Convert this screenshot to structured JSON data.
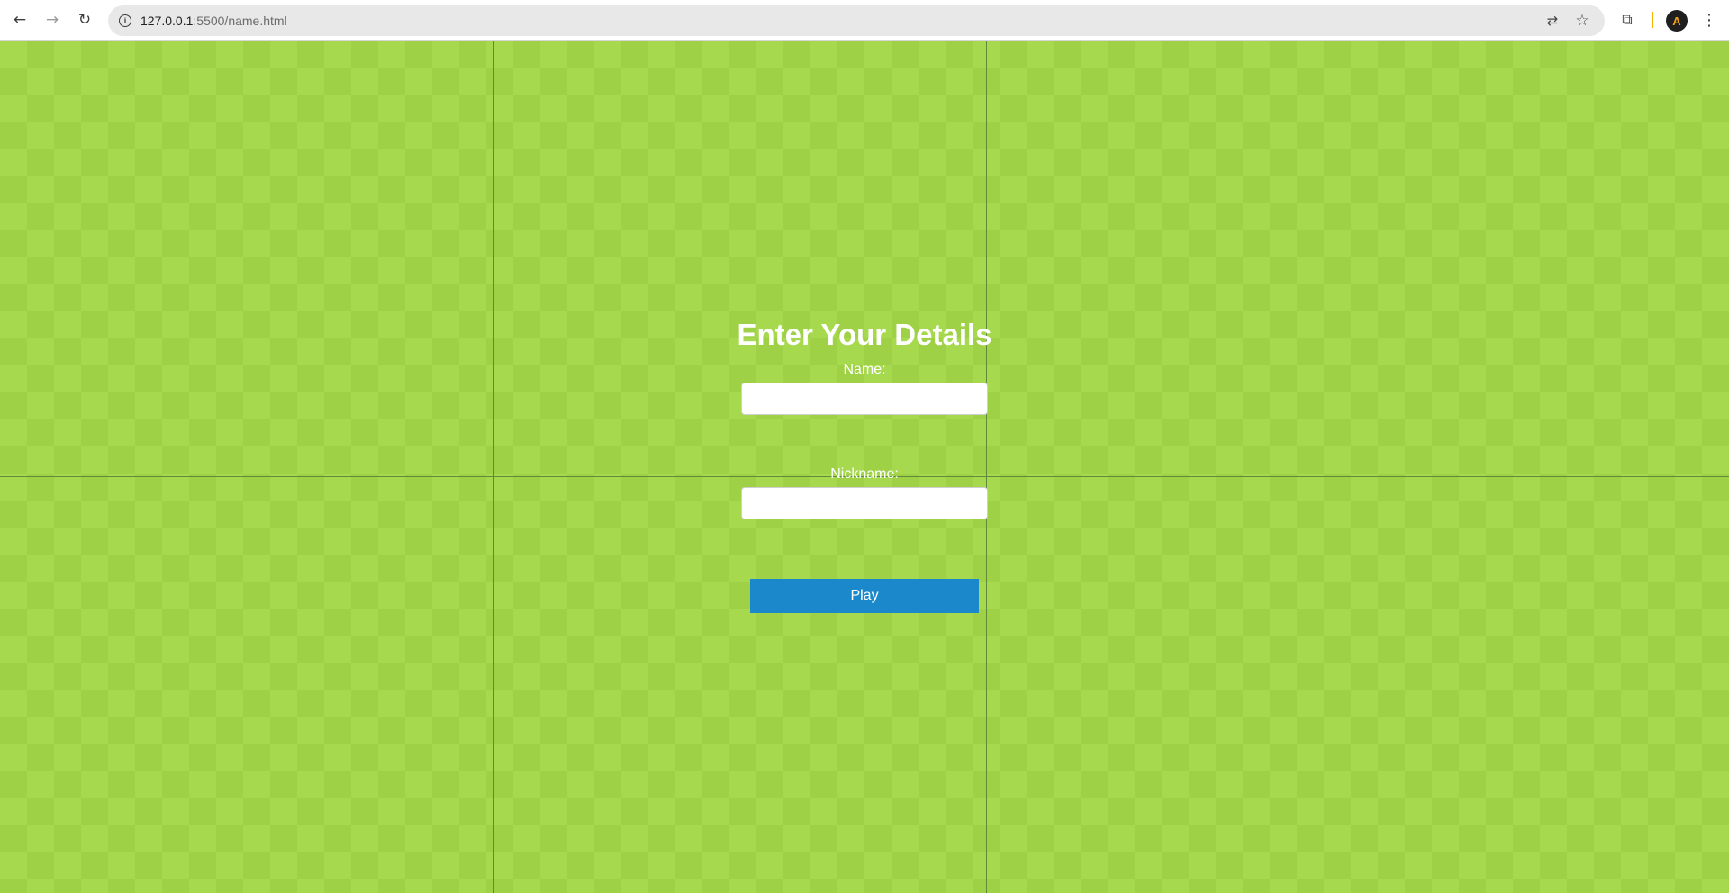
{
  "browser": {
    "url_host": "127.0.0.1",
    "url_rest": ":5500/name.html",
    "icons": {
      "back": "back-arrow-icon",
      "forward": "forward-arrow-icon",
      "reload": "reload-icon",
      "site_info": "info-icon",
      "translate": "translate-icon",
      "bookmark": "star-icon",
      "extensions": "puzzle-icon",
      "profile": "avatar",
      "menu": "kebab-menu-icon"
    },
    "avatar_letter": "A"
  },
  "form": {
    "title": "Enter Your Details",
    "name_label": "Name:",
    "name_value": "",
    "nickname_label": "Nickname:",
    "nickname_value": "",
    "play_label": "Play"
  },
  "colors": {
    "background_light": "#a6d94e",
    "background_dark": "#9fd146",
    "grid_line": "#5f8a3a",
    "button": "#1c88cc",
    "text": "#ffffff"
  }
}
